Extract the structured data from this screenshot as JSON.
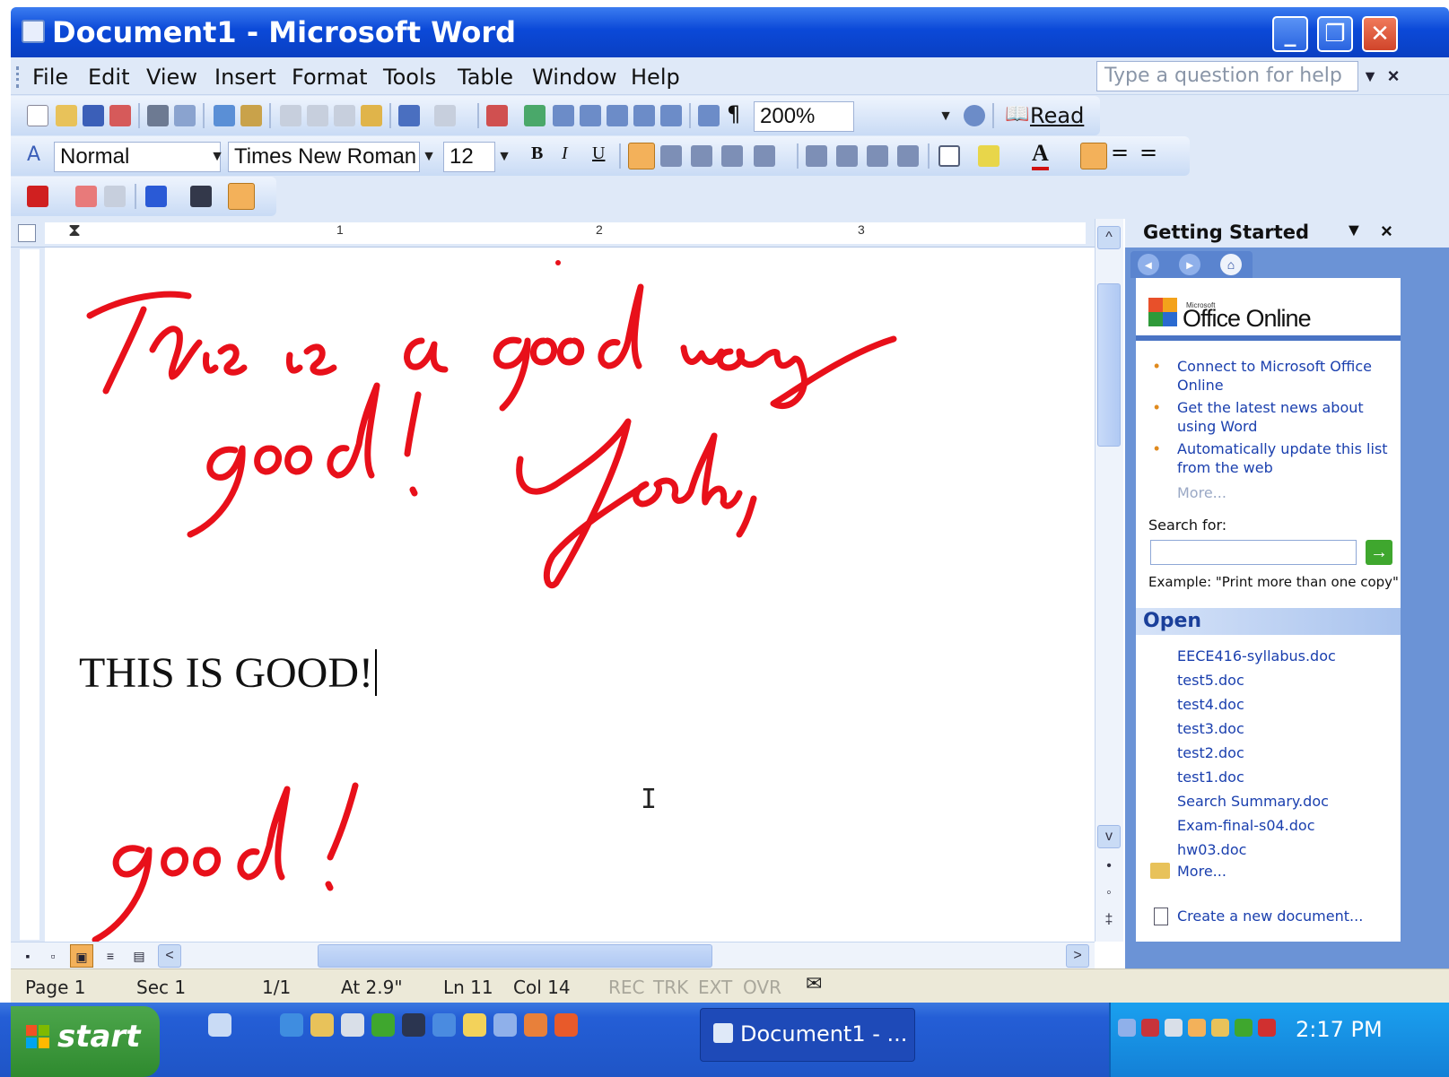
{
  "window": {
    "title": "Document1 - Microsoft Word"
  },
  "menu": {
    "items": [
      "File",
      "Edit",
      "View",
      "Insert",
      "Format",
      "Tools",
      "Table",
      "Window",
      "Help"
    ],
    "help_placeholder": "Type a question for help"
  },
  "standard_toolbar": {
    "zoom": "200%",
    "read_label": "Read"
  },
  "format_toolbar": {
    "style": "Normal",
    "font": "Times New Roman",
    "size": "12",
    "bold": "B",
    "italic": "I",
    "underline": "U"
  },
  "ruler": {
    "marks": [
      "1",
      "2",
      "3"
    ]
  },
  "document": {
    "typed_text": "THIS IS GOOD!",
    "ink_color": "#e8101a",
    "ink_phrases": [
      "This is a good way",
      "good! Yeah,",
      "good!"
    ]
  },
  "status_bar": {
    "page": "Page 1",
    "section": "Sec 1",
    "pages": "1/1",
    "at": "At 2.9\"",
    "line": "Ln 11",
    "col": "Col 14",
    "rec": "REC",
    "trk": "TRK",
    "ext": "EXT",
    "ovr": "OVR"
  },
  "task_pane": {
    "title": "Getting Started",
    "office_small": "Microsoft",
    "office_brand": "Office Online",
    "links": [
      "Connect to Microsoft Office Online",
      "Get the latest news about using Word",
      "Automatically update this list from the web"
    ],
    "more_link": "More...",
    "search_label": "Search for:",
    "example": "Example:  \"Print more than one copy\"",
    "open_title": "Open",
    "open_files": [
      "EECE416-syllabus.doc",
      "test5.doc",
      "test4.doc",
      "test3.doc",
      "test2.doc",
      "test1.doc",
      "Search Summary.doc",
      "Exam-final-s04.doc",
      "hw03.doc"
    ],
    "open_more": "More...",
    "create_new": "Create a new document..."
  },
  "taskbar": {
    "start_label": "start",
    "task_button_label": "Document1 - ...",
    "clock": "2:17 PM"
  },
  "colors": {
    "title_blue": "#0b49d8",
    "taskbar_blue": "#245ed6",
    "start_green": "#3a9a3a",
    "link_blue": "#1a3fae"
  }
}
